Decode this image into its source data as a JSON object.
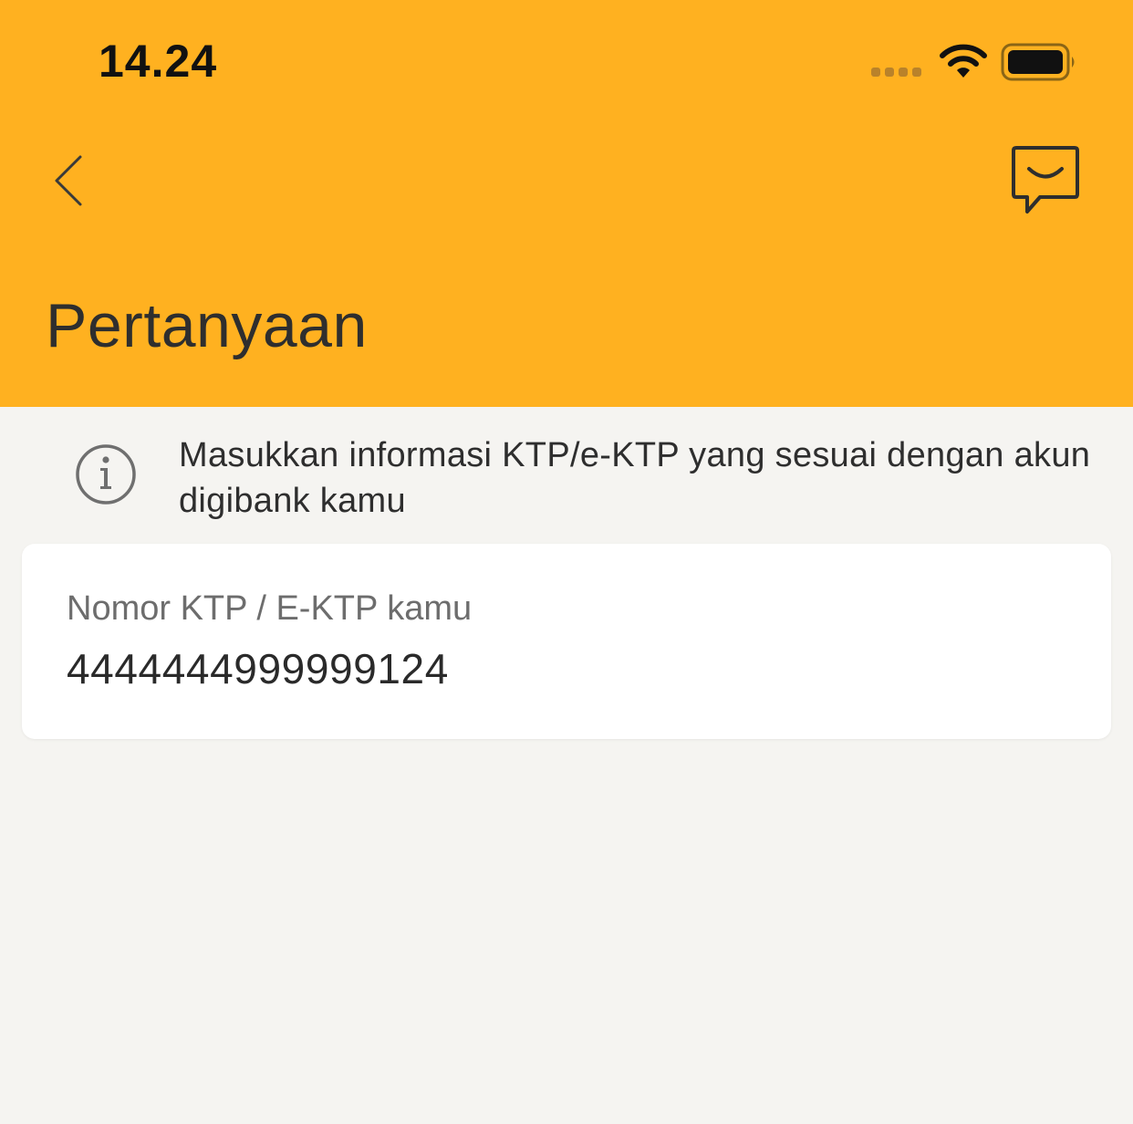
{
  "status_bar": {
    "time": "14.24"
  },
  "header": {
    "title": "Pertanyaan",
    "background_color": "#ffb120",
    "back_icon": "chevron-left-icon",
    "chat_icon": "chat-smile-icon"
  },
  "info": {
    "icon": "info-circle-icon",
    "text": "Masukkan informasi KTP/e-KTP yang sesuai dengan akun digibank kamu"
  },
  "card": {
    "label": "Nomor KTP / E-KTP kamu",
    "value": "4444444999999124"
  }
}
